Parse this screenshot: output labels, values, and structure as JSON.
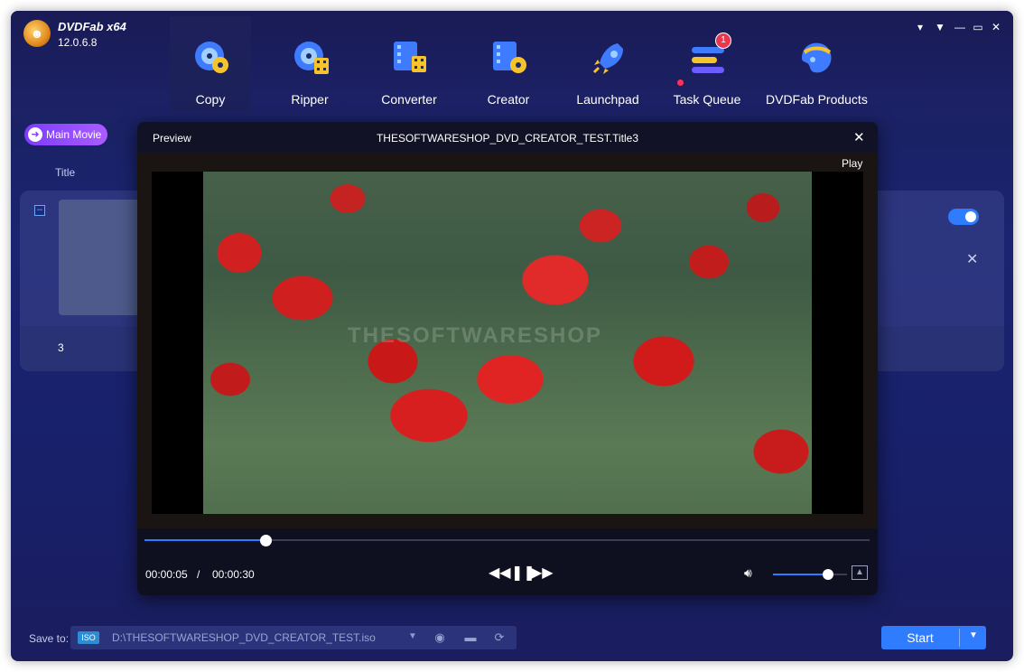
{
  "app": {
    "brand": "DVDFab x64",
    "version": "12.0.6.8"
  },
  "window_controls": [
    "shirt-icon",
    "menu-icon",
    "minimize-icon",
    "maximize-icon",
    "close-icon"
  ],
  "nav": [
    {
      "label": "Copy",
      "icon": "copy-disc-icon",
      "active": true
    },
    {
      "label": "Ripper",
      "icon": "ripper-icon"
    },
    {
      "label": "Converter",
      "icon": "converter-icon"
    },
    {
      "label": "Creator",
      "icon": "creator-icon"
    },
    {
      "label": "Launchpad",
      "icon": "rocket-icon"
    },
    {
      "label": "Task Queue",
      "icon": "task-queue-icon",
      "badge": "1"
    },
    {
      "label": "DVDFab Products",
      "icon": "products-icon"
    }
  ],
  "toolbar": {
    "main_movie": "Main Movie"
  },
  "list": {
    "header_title": "Title",
    "row_number": "3"
  },
  "preview": {
    "header_left": "Preview",
    "title": "THESOFTWARESHOP_DVD_CREATOR_TEST.Title3",
    "play_label": "Play",
    "watermark": "THESOFTWARESHOP",
    "current_time": "00:00:05",
    "separator": "/",
    "total_time": "00:00:30",
    "progress": 0.167,
    "volume": 0.74
  },
  "save": {
    "label": "Save to:",
    "format_tag": "ISO",
    "path": "D:\\THESOFTWARESHOP_DVD_CREATOR_TEST.iso"
  },
  "start": {
    "label": "Start"
  },
  "colors": {
    "accent": "#2f7cff",
    "badge": "#e8384f",
    "main_movie": "#8b48ff"
  }
}
